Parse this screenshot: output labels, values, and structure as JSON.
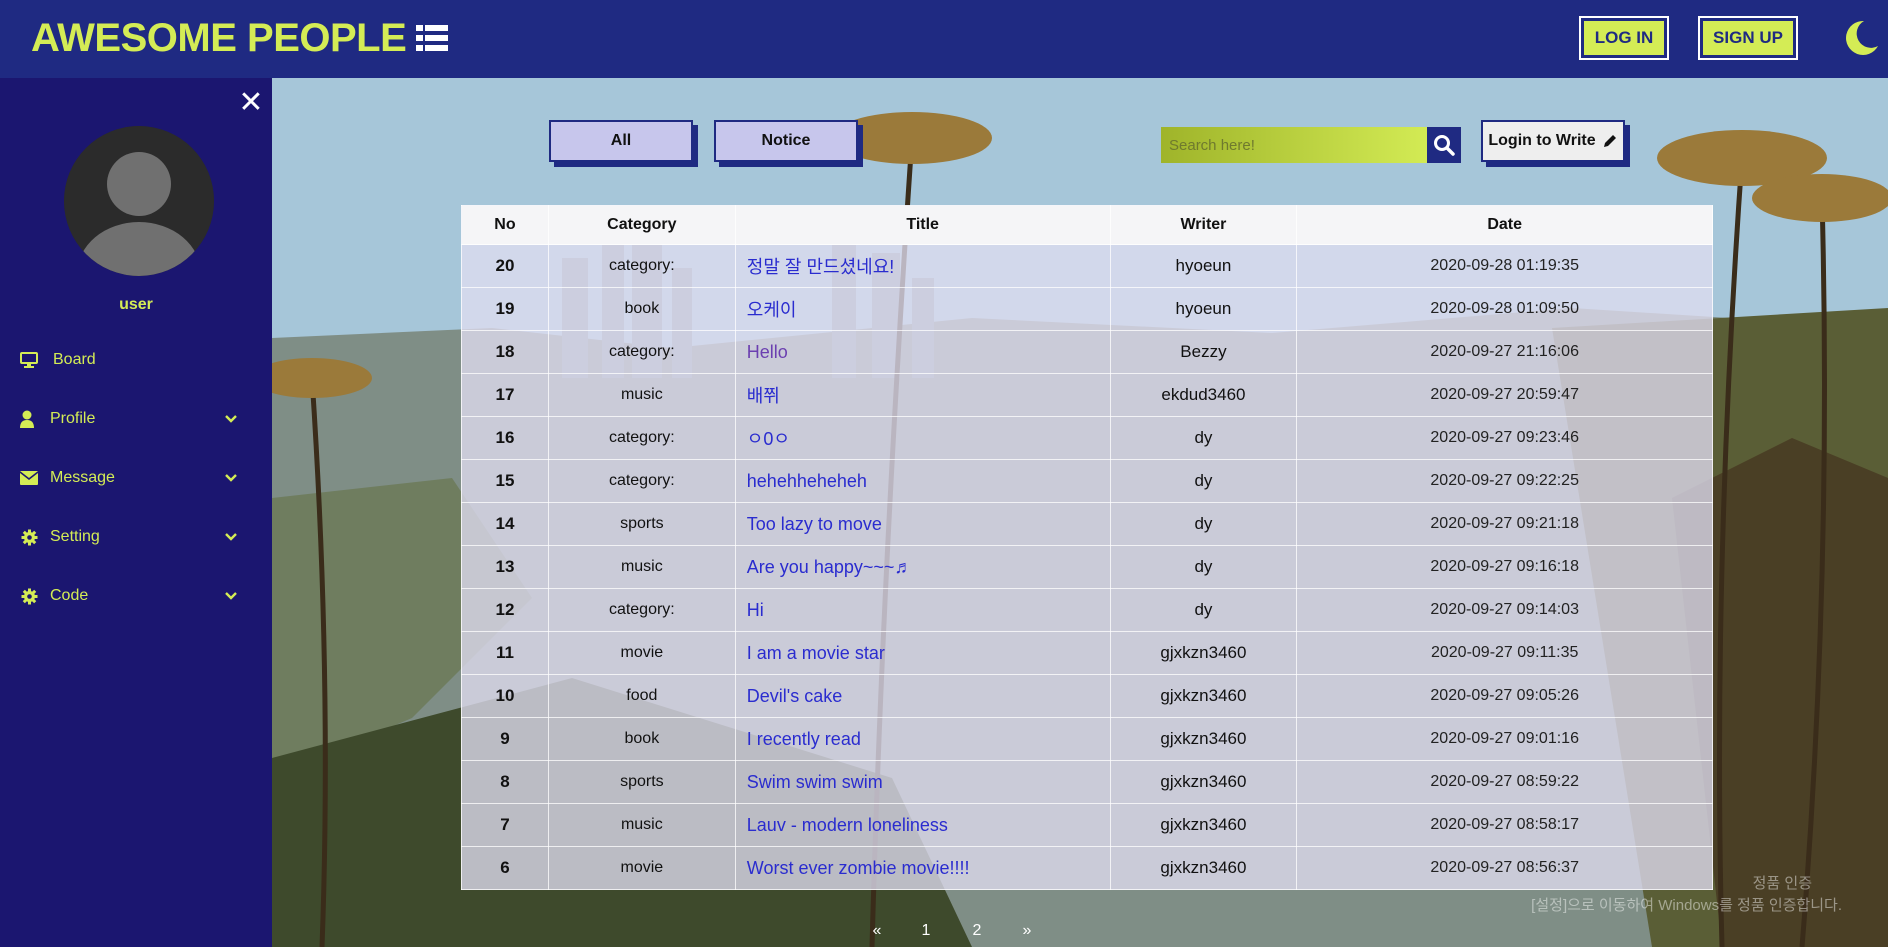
{
  "header": {
    "brand": "AWESOME PEOPLE",
    "login_label": "LOG IN",
    "signup_label": "SIGN UP"
  },
  "sidebar": {
    "username": "user",
    "close_glyph": "✕",
    "items": [
      {
        "label": "Board",
        "icon": "monitor-icon"
      },
      {
        "label": "Profile",
        "icon": "user-icon"
      },
      {
        "label": "Message",
        "icon": "envelope-icon"
      },
      {
        "label": "Setting",
        "icon": "gear-icon"
      },
      {
        "label": "Code",
        "icon": "gear-icon"
      }
    ]
  },
  "toolbar": {
    "filters": [
      "All",
      "Notice"
    ],
    "search_placeholder": "Search here!",
    "write_label": "Login to Write"
  },
  "table": {
    "columns": [
      "No",
      "Category",
      "Title",
      "Writer",
      "Date"
    ],
    "rows": [
      {
        "no": "20",
        "category": "category:",
        "title": "정말 잘 만드셨네요!",
        "writer": "hyoeun",
        "date": "2020-09-28 01:19:35"
      },
      {
        "no": "19",
        "category": "book",
        "title": "오케이",
        "writer": "hyoeun",
        "date": "2020-09-28 01:09:50"
      },
      {
        "no": "18",
        "category": "category:",
        "title": "Hello",
        "writer": "Bezzy",
        "date": "2020-09-27 21:16:06"
      },
      {
        "no": "17",
        "category": "music",
        "title": "배쮜",
        "writer": "ekdud3460",
        "date": "2020-09-27 20:59:47"
      },
      {
        "no": "16",
        "category": "category:",
        "title": "ㅇ0ㅇ",
        "writer": "dy",
        "date": "2020-09-27 09:23:46"
      },
      {
        "no": "15",
        "category": "category:",
        "title": "hehehheheheh",
        "writer": "dy",
        "date": "2020-09-27 09:22:25"
      },
      {
        "no": "14",
        "category": "sports",
        "title": "Too lazy to move",
        "writer": "dy",
        "date": "2020-09-27 09:21:18"
      },
      {
        "no": "13",
        "category": "music",
        "title": "Are you happy~~~♬",
        "writer": "dy",
        "date": "2020-09-27 09:16:18"
      },
      {
        "no": "12",
        "category": "category:",
        "title": "Hi",
        "writer": "dy",
        "date": "2020-09-27 09:14:03"
      },
      {
        "no": "11",
        "category": "movie",
        "title": "I am a movie star",
        "writer": "gjxkzn3460",
        "date": "2020-09-27 09:11:35"
      },
      {
        "no": "10",
        "category": "food",
        "title": "Devil's cake",
        "writer": "gjxkzn3460",
        "date": "2020-09-27 09:05:26"
      },
      {
        "no": "9",
        "category": "book",
        "title": "I recently read",
        "writer": "gjxkzn3460",
        "date": "2020-09-27 09:01:16"
      },
      {
        "no": "8",
        "category": "sports",
        "title": "Swim swim swim",
        "writer": "gjxkzn3460",
        "date": "2020-09-27 08:59:22"
      },
      {
        "no": "7",
        "category": "music",
        "title": "Lauv - modern loneliness",
        "writer": "gjxkzn3460",
        "date": "2020-09-27 08:58:17"
      },
      {
        "no": "6",
        "category": "movie",
        "title": "Worst ever zombie movie!!!!",
        "writer": "gjxkzn3460",
        "date": "2020-09-27 08:56:37"
      }
    ]
  },
  "pagination": {
    "prev": "«",
    "pages": [
      "1",
      "2"
    ],
    "next": "»"
  },
  "watermark": {
    "line1": "정품 인증",
    "line2": "[설정]으로 이동하여 Windows를 정품 인증합니다."
  },
  "colors": {
    "header_bg": "#1f2a82",
    "sidebar_bg": "#1b1670",
    "accent": "#d4ec55",
    "title_link": "#2a2ccf"
  }
}
